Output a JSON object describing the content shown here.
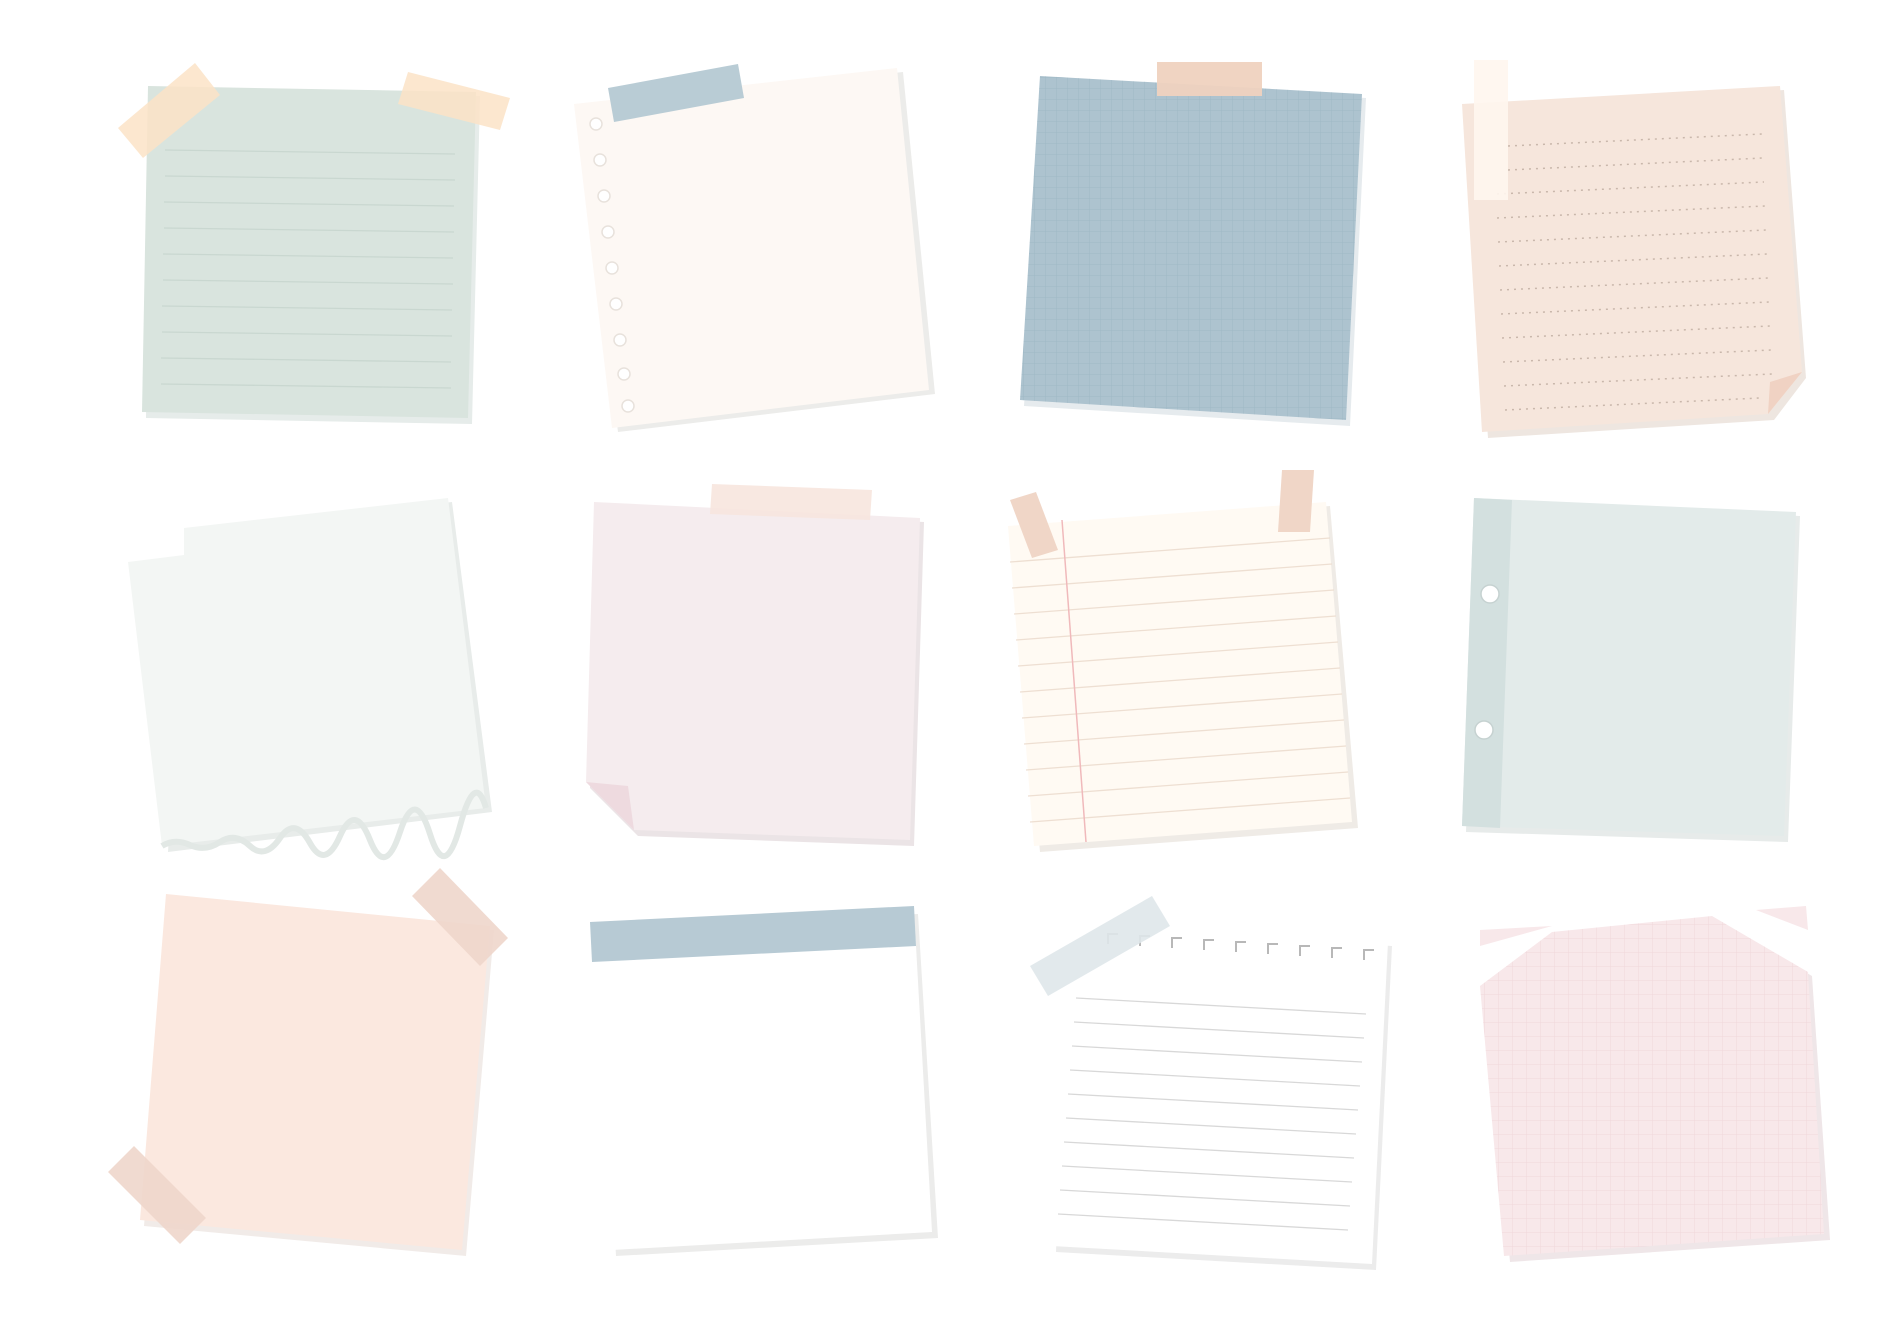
{
  "canvas": {
    "background": "#ffffff"
  },
  "notes": [
    {
      "id": "sage-lined",
      "color": "#d9e4de",
      "pattern": "lined",
      "tapes": 2
    },
    {
      "id": "cream-spiral",
      "color": "#fdf8f4",
      "pattern": "spiral-holes",
      "tapes": 1
    },
    {
      "id": "blue-grid",
      "color": "#adc3cf",
      "pattern": "grid",
      "tapes": 1
    },
    {
      "id": "peach-dotted",
      "color": "#f6e6dc",
      "pattern": "dotted-lines",
      "tapes": 1,
      "folded_corner": "bottom-right"
    },
    {
      "id": "mint-torn",
      "color": "#f3f6f4",
      "pattern": "torn-edges",
      "tapes": 0
    },
    {
      "id": "blush-plain",
      "color": "#f5ecee",
      "pattern": "plain",
      "tapes": 1,
      "folded_corner": "bottom-left"
    },
    {
      "id": "ivory-legal",
      "color": "#fffaf3",
      "pattern": "legal-ruled",
      "tapes": 2
    },
    {
      "id": "grey-binder",
      "color": "#e3ebea",
      "pattern": "binder-holes",
      "tapes": 0
    },
    {
      "id": "peach-plain",
      "color": "#fbe8df",
      "pattern": "plain",
      "tapes": 2
    },
    {
      "id": "white-header",
      "color": "#ffffff",
      "pattern": "header-band",
      "tapes": 0
    },
    {
      "id": "white-notebook",
      "color": "#ffffff",
      "pattern": "lined-perforated",
      "tapes": 1
    },
    {
      "id": "pink-grid",
      "color": "#f8e8ea",
      "pattern": "grid",
      "tapes": 0
    }
  ]
}
